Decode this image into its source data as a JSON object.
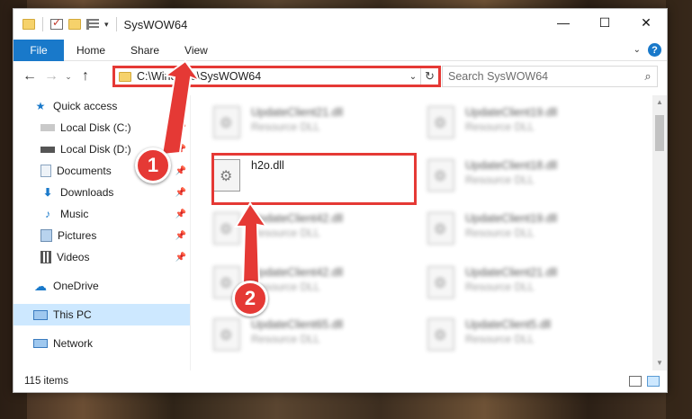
{
  "window": {
    "title": "SysWOW64",
    "controls": [
      "—",
      "☐",
      "✕"
    ]
  },
  "ribbon": {
    "file": "File",
    "tabs": [
      "Home",
      "Share",
      "View"
    ]
  },
  "nav": {
    "path": "C:\\Windows\\SysWOW64",
    "search_placeholder": "Search SysWOW64"
  },
  "sidebar": {
    "items": [
      {
        "label": "Quick access",
        "icon": "star-icon",
        "pinned": false
      },
      {
        "label": "Local Disk (C:)",
        "icon": "drive-icon",
        "pinned": true
      },
      {
        "label": "Local Disk (D:)",
        "icon": "drive-icon",
        "pinned": true
      },
      {
        "label": "Documents",
        "icon": "documents-icon",
        "pinned": true
      },
      {
        "label": "Downloads",
        "icon": "download-icon",
        "pinned": true
      },
      {
        "label": "Music",
        "icon": "music-icon",
        "pinned": true
      },
      {
        "label": "Pictures",
        "icon": "pictures-icon",
        "pinned": true
      },
      {
        "label": "Videos",
        "icon": "videos-icon",
        "pinned": true
      },
      {
        "label": "OneDrive",
        "icon": "cloud-icon",
        "pinned": false
      },
      {
        "label": "This PC",
        "icon": "computer-icon",
        "pinned": false,
        "selected": true
      },
      {
        "label": "Network",
        "icon": "network-icon",
        "pinned": false
      }
    ]
  },
  "files": [
    {
      "name": "UpdateClient21.dll",
      "type": "Resource DLL"
    },
    {
      "name": "UpdateClient19.dll",
      "type": "Resource DLL"
    },
    {
      "name": "h2o.dll",
      "type": ""
    },
    {
      "name": "UpdateClient18.dll",
      "type": "Resource DLL"
    },
    {
      "name": "UpdateClient42.dll",
      "type": "Resource DLL"
    },
    {
      "name": "UpdateClient19.dll",
      "type": "Resource DLL"
    },
    {
      "name": "UpdateClient42.dll",
      "type": "Resource DLL"
    },
    {
      "name": "UpdateClient21.dll",
      "type": "Resource DLL"
    },
    {
      "name": "UpdateClient65.dll",
      "type": "Resource DLL"
    },
    {
      "name": "UpdateClient5.dll",
      "type": "Resource DLL"
    }
  ],
  "status": {
    "item_count": "115 items"
  },
  "annotations": {
    "step1": "1",
    "step2": "2"
  },
  "colors": {
    "accent": "#1979ca",
    "highlight": "#e53935",
    "selection": "#cde8ff"
  }
}
